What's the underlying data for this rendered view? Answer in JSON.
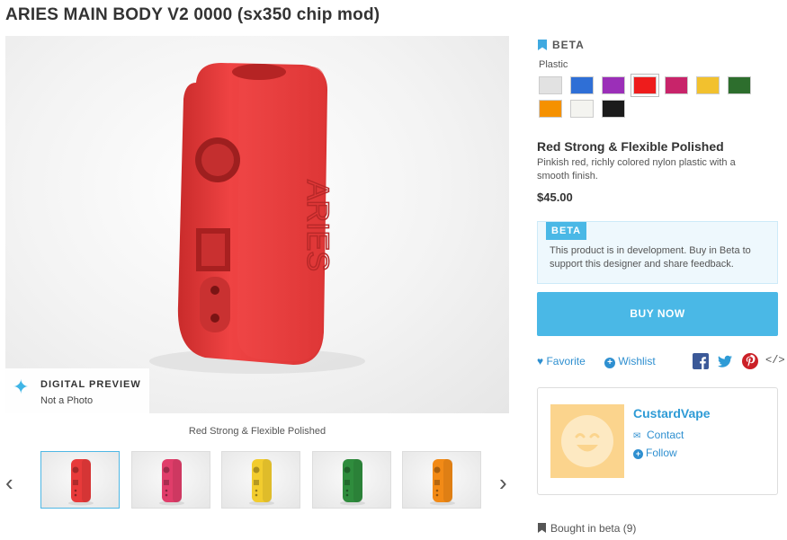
{
  "title": "ARIES MAIN BODY V2 0000 (sx350 chip mod)",
  "preview": {
    "title": "DIGITAL PREVIEW",
    "subtitle": "Not a Photo"
  },
  "model_text": "ARIES",
  "caption": "Red Strong & Flexible Polished",
  "nav": {
    "prev": "‹",
    "next": "›"
  },
  "thumbnails": [
    {
      "color": "#e83a3a",
      "active": true
    },
    {
      "color": "#e03d6a",
      "active": false
    },
    {
      "color": "#f2cc2e",
      "active": false
    },
    {
      "color": "#2f8c3d",
      "active": false
    },
    {
      "color": "#f28a16",
      "active": false
    }
  ],
  "beta_label": "BETA",
  "material_label": "Plastic",
  "swatches": [
    {
      "name": "white",
      "color": "#e2e2e2",
      "selected": false
    },
    {
      "name": "blue",
      "color": "#2f6fd6",
      "selected": false
    },
    {
      "name": "purple",
      "color": "#9b2fb8",
      "selected": false
    },
    {
      "name": "red",
      "color": "#ee1c1c",
      "selected": true
    },
    {
      "name": "pink",
      "color": "#c8246a",
      "selected": false
    },
    {
      "name": "yellow",
      "color": "#f2c12e",
      "selected": false
    },
    {
      "name": "green",
      "color": "#2d6e2d",
      "selected": false
    },
    {
      "name": "orange",
      "color": "#f59100",
      "selected": false
    },
    {
      "name": "polished-white",
      "color": "#f4f4f0",
      "selected": false
    },
    {
      "name": "black",
      "color": "#1b1b1b",
      "selected": false
    }
  ],
  "product": {
    "name": "Red Strong & Flexible Polished",
    "description": "Pinkish red, richly colored nylon plastic with a smooth finish.",
    "price": "$45.00"
  },
  "beta_box": {
    "tag": "BETA",
    "text": "This product is in development. Buy in Beta to support this designer and share feedback."
  },
  "buy_label": "BUY NOW",
  "actions": {
    "favorite": "Favorite",
    "wishlist": "Wishlist"
  },
  "designer": {
    "name": "CustardVape",
    "contact": "Contact",
    "follow": "Follow"
  },
  "bought": "Bought in beta (9)",
  "colors": {
    "accent": "#4ab8e6",
    "link": "#2e8fd0",
    "product": "#ee3b3b"
  }
}
